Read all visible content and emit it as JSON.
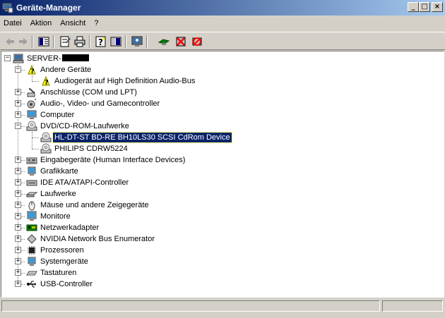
{
  "window": {
    "title": "Geräte-Manager"
  },
  "menu": [
    {
      "label": "Datei"
    },
    {
      "label": "Aktion"
    },
    {
      "label": "Ansicht"
    },
    {
      "label": "?"
    }
  ],
  "toolbar": {
    "buttons": [
      "back-arrow-icon",
      "forward-arrow-icon",
      "console-tree-icon",
      "properties-icon",
      "print-icon",
      "help-icon",
      "view-icon",
      "scan-hardware-icon",
      "update-driver-icon",
      "uninstall-icon",
      "disable-icon"
    ]
  },
  "tree": {
    "root_prefix": "SERVER-",
    "items": [
      {
        "label": "Andere Geräte",
        "icon": "unknown-device-icon",
        "level": 1,
        "expanded": true
      },
      {
        "label": "Audiogerät auf High Definition Audio-Bus",
        "icon": "unknown-device-icon",
        "level": 2
      },
      {
        "label": "Anschlüsse (COM und LPT)",
        "icon": "port-icon",
        "level": 1
      },
      {
        "label": "Audio-, Video- und Gamecontroller",
        "icon": "audio-icon",
        "level": 1
      },
      {
        "label": "Computer",
        "icon": "computer-icon",
        "level": 1
      },
      {
        "label": "DVD/CD-ROM-Laufwerke",
        "icon": "cdrom-icon",
        "level": 1,
        "expanded": true
      },
      {
        "label": "HL-DT-ST BD-RE  BH10LS30 SCSI CdRom Device",
        "icon": "cdrom-icon",
        "level": 2,
        "selected": true
      },
      {
        "label": "PHILIPS CDRW5224",
        "icon": "cdrom-icon",
        "level": 2
      },
      {
        "label": "Eingabegeräte (Human Interface Devices)",
        "icon": "hid-icon",
        "level": 1
      },
      {
        "label": "Grafikkarte",
        "icon": "display-adapter-icon",
        "level": 1
      },
      {
        "label": "IDE ATA/ATAPI-Controller",
        "icon": "ide-controller-icon",
        "level": 1
      },
      {
        "label": "Laufwerke",
        "icon": "disk-drive-icon",
        "level": 1
      },
      {
        "label": "Mäuse und andere Zeigegeräte",
        "icon": "mouse-icon",
        "level": 1
      },
      {
        "label": "Monitore",
        "icon": "monitor-icon",
        "level": 1
      },
      {
        "label": "Netzwerkadapter",
        "icon": "network-adapter-icon",
        "level": 1
      },
      {
        "label": "NVIDIA Network Bus Enumerator",
        "icon": "bus-enumerator-icon",
        "level": 1
      },
      {
        "label": "Prozessoren",
        "icon": "processor-icon",
        "level": 1
      },
      {
        "label": "Systemgeräte",
        "icon": "system-device-icon",
        "level": 1
      },
      {
        "label": "Tastaturen",
        "icon": "keyboard-icon",
        "level": 1
      },
      {
        "label": "USB-Controller",
        "icon": "usb-icon",
        "level": 1
      }
    ]
  },
  "colors": {
    "titlebar_start": "#0a246a",
    "titlebar_end": "#a6caf0",
    "selection": "#0a246a",
    "chrome": "#d4d0c8"
  }
}
